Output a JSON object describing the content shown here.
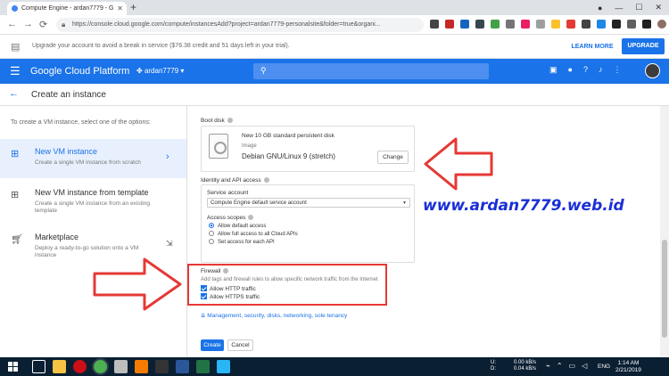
{
  "browser": {
    "tab_title": "Compute Engine - ardan7779 - G",
    "url": "https://console.cloud.google.com/compute/instancesAdd?project=ardan7779-personalsite&folder=true&organi..."
  },
  "promo": {
    "text": "Upgrade your account to avoid a break in service ($76.38 credit and 51 days left in your trial).",
    "learn_more": "LEARN MORE",
    "upgrade": "UPGRADE"
  },
  "header": {
    "brand": "Google Cloud Platform",
    "project": "ardan7779"
  },
  "subheader": {
    "title": "Create an instance"
  },
  "sidebar": {
    "intro": "To create a VM instance, select one of the options:",
    "options": [
      {
        "title": "New VM instance",
        "desc": "Create a single VM instance from scratch"
      },
      {
        "title": "New VM instance from template",
        "desc": "Create a single VM instance from an existing template"
      },
      {
        "title": "Marketplace",
        "desc": "Deploy a ready-to-go solution onto a VM instance"
      }
    ]
  },
  "boot_disk": {
    "label": "Boot disk",
    "disk_desc": "New 10 GB standard persistent disk",
    "image_label": "Image",
    "image_name": "Debian GNU/Linux 9 (stretch)",
    "change_button": "Change"
  },
  "identity": {
    "section_label": "Identity and API access",
    "service_account_label": "Service account",
    "service_account_value": "Compute Engine default service account",
    "access_scopes_label": "Access scopes",
    "scopes": [
      {
        "label": "Allow default access",
        "selected": true
      },
      {
        "label": "Allow full access to all Cloud APIs",
        "selected": false
      },
      {
        "label": "Set access for each API",
        "selected": false
      }
    ]
  },
  "firewall": {
    "label": "Firewall",
    "desc": "Add tags and firewall rules to allow specific network traffic from the Internet",
    "http": "Allow HTTP traffic",
    "https": "Allow HTTPS traffic"
  },
  "more_link": "Management, security, disks, networking, sole tenancy",
  "actions": {
    "create": "Create",
    "cancel": "Cancel"
  },
  "watermark": "www.ardan7779.web.id",
  "taskbar": {
    "tray_ud": "U:\nD:",
    "net_up": "0.00 kB/s",
    "net_down": "0.04 kB/s",
    "lang": "ENG",
    "time": "1:14 AM",
    "date": "2/21/2019"
  },
  "colors": {
    "brand_blue": "#1a73e8",
    "annotation_red": "#e53935",
    "watermark_blue": "#1a2fd6"
  }
}
